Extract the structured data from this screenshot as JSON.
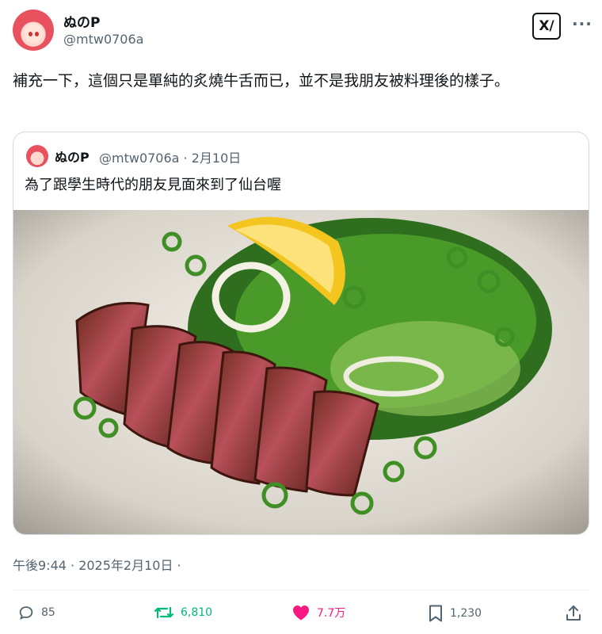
{
  "author": {
    "display_name": "ぬのP",
    "handle": "@mtw0706a"
  },
  "header": {
    "grok_label": "X/",
    "more_label": "···"
  },
  "tweet": {
    "text": "補充一下，這個只是單純的炙燒牛舌而已，並不是我朋友被料理後的樣子。"
  },
  "quoted_tweet": {
    "display_name": "ぬのP",
    "handle_date": "@mtw0706a · 2月10日",
    "text": "為了跟學生時代的朋友見面來到了仙台喔"
  },
  "meta": {
    "timestamp": "午後9:44 · 2025年2月10日 ·"
  },
  "actions": {
    "replies": "85",
    "reposts": "6,810",
    "likes": "7.7万",
    "bookmarks": "1,230"
  },
  "colors": {
    "repost": "#00ba7c",
    "like": "#f91880",
    "muted": "#536471"
  }
}
